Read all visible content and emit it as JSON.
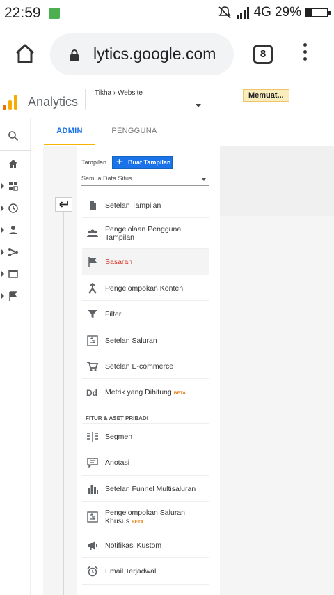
{
  "status_bar": {
    "time": "22:59",
    "network": "4G",
    "battery": "29%",
    "battery_level": 0.29
  },
  "browser": {
    "url": "lytics.google.com",
    "tab_count": "8"
  },
  "ga_header": {
    "app_name": "Analytics",
    "breadcrumb_account": "Tikha",
    "breadcrumb_property": "Website",
    "loading_label": "Memuat..."
  },
  "tabs": {
    "admin": "ADMIN",
    "users": "PENGGUNA"
  },
  "view": {
    "label": "Tampilan",
    "create_button": "Buat Tampilan",
    "selected": "Semua Data Situs"
  },
  "menu": {
    "items": [
      {
        "label": "Setelan Tampilan",
        "icon": "document-icon"
      },
      {
        "label": "Pengelolaan Pengguna Tampilan",
        "icon": "people-icon"
      },
      {
        "label": "Sasaran",
        "icon": "flag-icon"
      },
      {
        "label": "Pengelompokan Konten",
        "icon": "merge-icon"
      },
      {
        "label": "Filter",
        "icon": "filter-icon"
      },
      {
        "label": "Setelan Saluran",
        "icon": "channel-settings-icon"
      },
      {
        "label": "Setelan E-commerce",
        "icon": "cart-icon"
      },
      {
        "label": "Metrik yang Dihitung",
        "icon": "dd-icon",
        "badge": "BETA"
      }
    ],
    "section_title": "FITUR & ASET PRIBADI",
    "personal_items": [
      {
        "label": "Segmen",
        "icon": "segment-icon"
      },
      {
        "label": "Anotasi",
        "icon": "comment-icon"
      },
      {
        "label": "Setelan Funnel Multisaluran",
        "icon": "bar-chart-icon"
      },
      {
        "label": "Pengelompokan Saluran Khusus",
        "icon": "channel-grouping-icon",
        "badge": "BETA"
      },
      {
        "label": "Notifikasi Kustom",
        "icon": "megaphone-icon"
      },
      {
        "label": "Email Terjadwal",
        "icon": "alarm-icon"
      }
    ]
  },
  "colors": {
    "accent_blue": "#1a73e8",
    "active_red": "#d93025",
    "tab_underline": "#f4b400",
    "beta_orange": "#e37400"
  }
}
